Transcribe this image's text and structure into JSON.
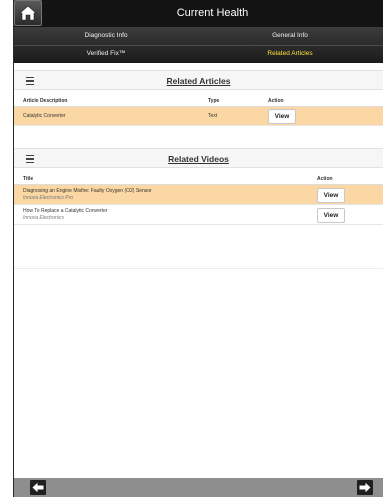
{
  "header": {
    "title": "Current Health"
  },
  "tabs": [
    {
      "label": "Diagnostic Info"
    },
    {
      "label": "General Info"
    },
    {
      "label": "Verified Fix™"
    },
    {
      "label": "Related Articles"
    }
  ],
  "articles": {
    "title": "Related Articles",
    "columns": {
      "description": "Article Description",
      "type": "Type",
      "action": "Action"
    },
    "rows": [
      {
        "description": "Catalytic Converter",
        "type": "Text",
        "action_label": "View"
      }
    ]
  },
  "videos": {
    "title": "Related Videos",
    "columns": {
      "title": "Title",
      "action": "Action"
    },
    "rows": [
      {
        "title": "Diagnosing an Engine Misfire: Faulty Oxygen (O2) Sensor",
        "source": "Innova Electronics Pro",
        "action_label": "View"
      },
      {
        "title": "How To Replace a Catalytic Converter",
        "source": "Innova Electronics",
        "action_label": "View"
      }
    ]
  },
  "colors": {
    "header_bg": "#131313",
    "active_tab": "#ffe23a",
    "highlight_row": "#fbd7a3",
    "bottom_bar": "#8e8e8e"
  },
  "icons": {
    "home": "home-icon",
    "menu": "menu-icon",
    "back": "arrow-left-icon",
    "forward": "arrow-right-icon"
  }
}
